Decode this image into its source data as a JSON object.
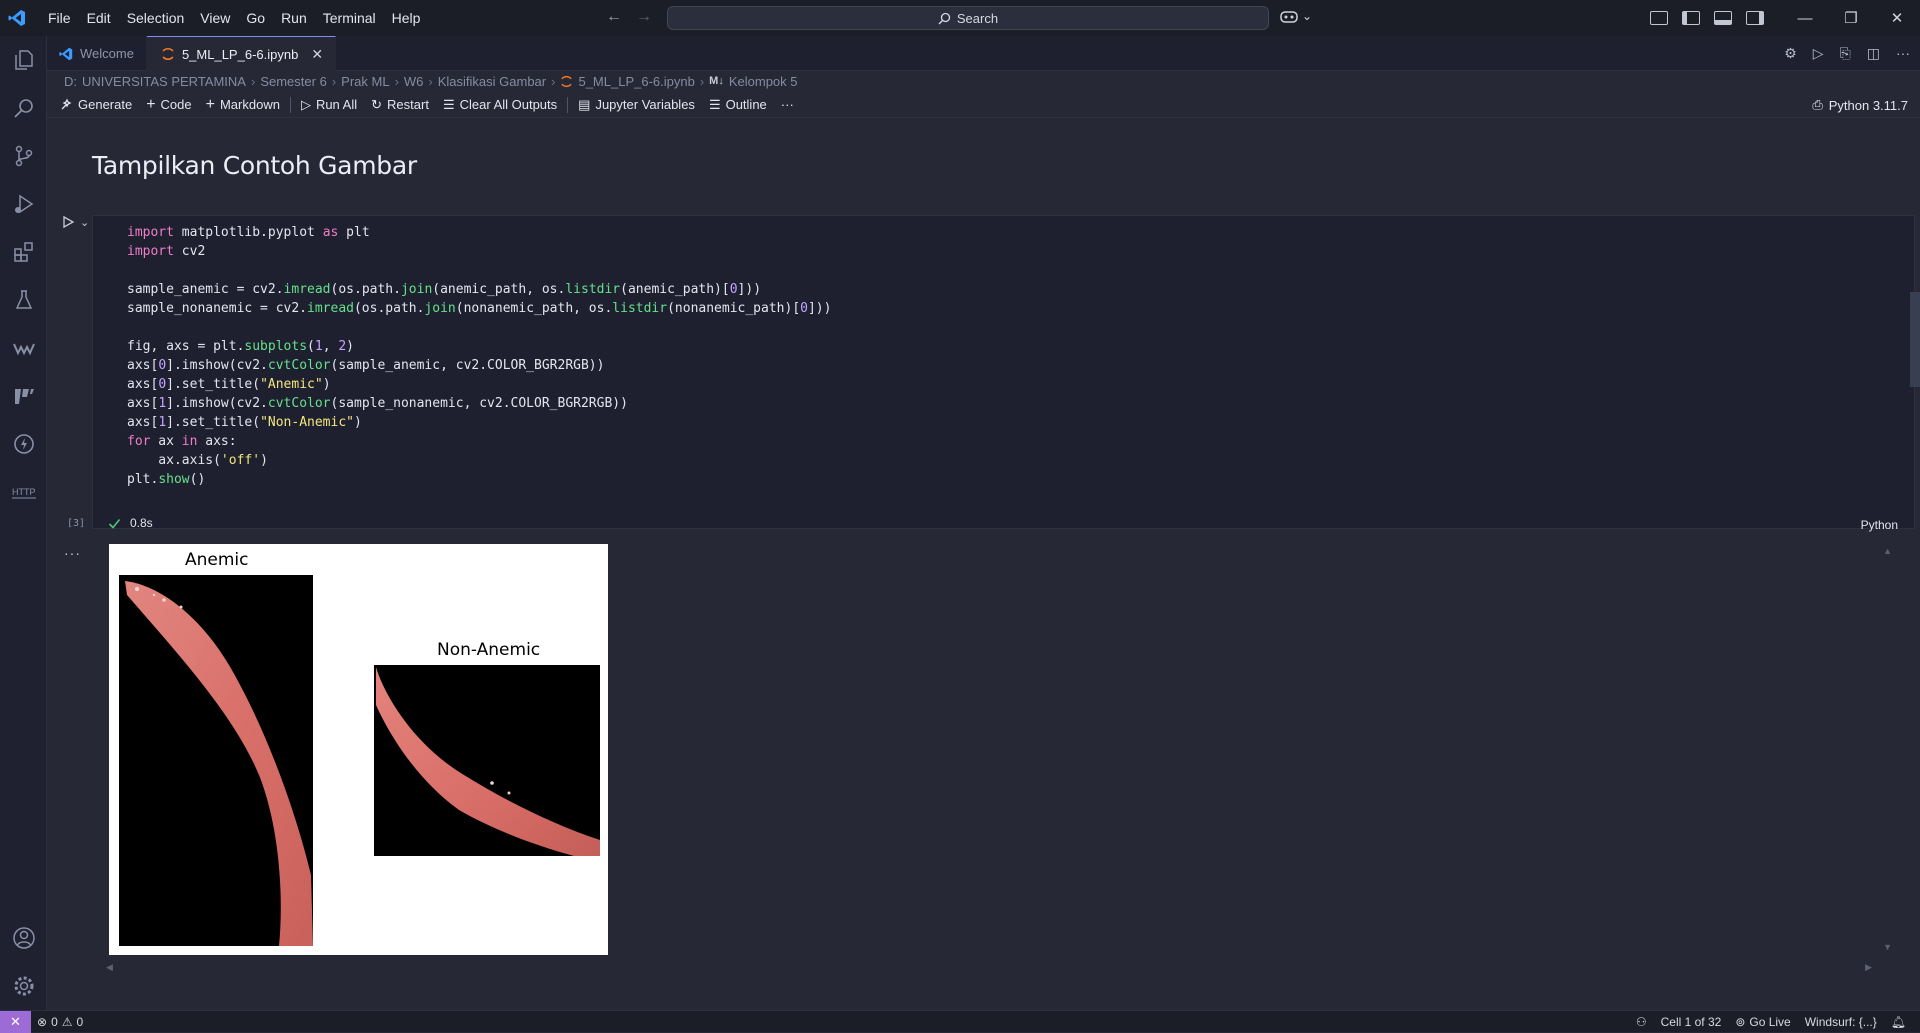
{
  "menu": [
    "File",
    "Edit",
    "Selection",
    "View",
    "Go",
    "Run",
    "Terminal",
    "Help"
  ],
  "search": {
    "label": "Search"
  },
  "tabs": [
    {
      "label": "Welcome"
    },
    {
      "label": "5_ML_LP_6-6.ipynb"
    }
  ],
  "breadcrumb": [
    "D:",
    "UNIVERSITAS PERTAMINA",
    "Semester 6",
    "Prak ML",
    "W6",
    "Klasifikasi Gambar",
    "5_ML_LP_6-6.ipynb",
    "M↓",
    "Kelompok 5"
  ],
  "toolbar": {
    "generate": "Generate",
    "code": "Code",
    "markdown": "Markdown",
    "run_all": "Run All",
    "restart": "Restart",
    "clear_outputs": "Clear All Outputs",
    "jupyter_vars": "Jupyter Variables",
    "outline": "Outline",
    "more": "···",
    "kernel": "Python 3.11.7"
  },
  "notebook": {
    "heading": "Tampilkan Contoh Gambar",
    "exec_count": "[3]",
    "exec_time": "0.8s",
    "language": "Python",
    "output_more": "···"
  },
  "figure": {
    "left_title": "Anemic",
    "right_title": "Non-Anemic"
  },
  "statusbar": {
    "errors": "0",
    "warnings": "0",
    "cell": "Cell 1 of 32",
    "golive": "Go Live",
    "windsurf": "Windsurf: {...}"
  },
  "colors": {
    "accent": "#7c8cff",
    "remote": "#9d6bd6",
    "success": "#4ec47a"
  }
}
